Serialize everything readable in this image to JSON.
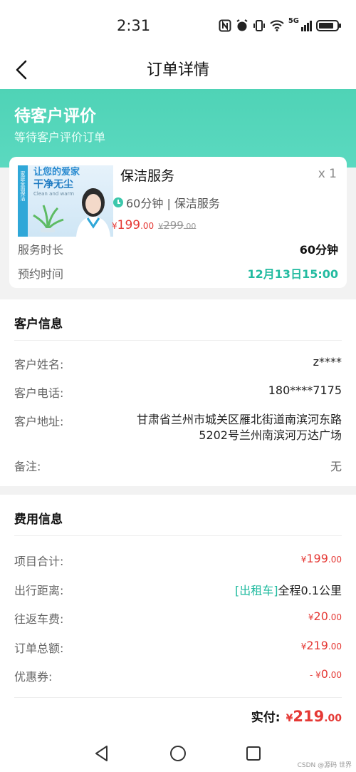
{
  "status": {
    "time": "2:31",
    "network": "5G"
  },
  "nav": {
    "title": "订单详情",
    "back_icon": "chevron-left-icon"
  },
  "header": {
    "title": "待客户评价",
    "subtitle": "等待客户评价订单"
  },
  "service": {
    "image_text_1": "让您的爱家",
    "image_text_2": "干净无尘",
    "image_text_3": "Clean and warm",
    "image_band_text": "家庭全面保洁",
    "name": "保洁服务",
    "quantity": "x 1",
    "duration_desc": "60分钟 | 保洁服务",
    "price_currency": "¥",
    "price_int": "199",
    "price_dec": ".00",
    "old_price_currency": "¥",
    "old_price_int": "299",
    "old_price_dec": ".00",
    "duration_label": "服务时长",
    "duration_value": "60分钟",
    "appointment_label": "预约时间",
    "appointment_value": "12月13日15:00"
  },
  "customer": {
    "section_title": "客户信息",
    "name_label": "客户姓名:",
    "name_value": "z****",
    "phone_label": "客户电话:",
    "phone_value": "180****7175",
    "address_label": "客户地址:",
    "address_line1": "甘肃省兰州市城关区雁北街道南滨河东路",
    "address_line2": "5202号兰州南滨河万达广场",
    "remark_label": "备注:",
    "remark_value": "无"
  },
  "fees": {
    "section_title": "费用信息",
    "subtotal_label": "项目合计:",
    "subtotal_cur": "¥",
    "subtotal_int": "199",
    "subtotal_dec": ".00",
    "distance_label": "出行距离:",
    "distance_tag": "[出租车]",
    "distance_value": "全程0.1公里",
    "fare_label": "往返车费:",
    "fare_cur": "¥",
    "fare_int": "20",
    "fare_dec": ".00",
    "total_label": "订单总额:",
    "total_cur": "¥",
    "total_int": "219",
    "total_dec": ".00",
    "coupon_label": "优惠券:",
    "coupon_prefix": "- ¥",
    "coupon_int": "0",
    "coupon_dec": ".00",
    "paid_label": "实付:",
    "paid_cur": "¥",
    "paid_int": "219",
    "paid_dec": ".00"
  },
  "watermark": "CSDN @源码 世界",
  "colors": {
    "accent": "#4fd3b6",
    "price": "#e53935",
    "teal_text": "#22bba0"
  }
}
